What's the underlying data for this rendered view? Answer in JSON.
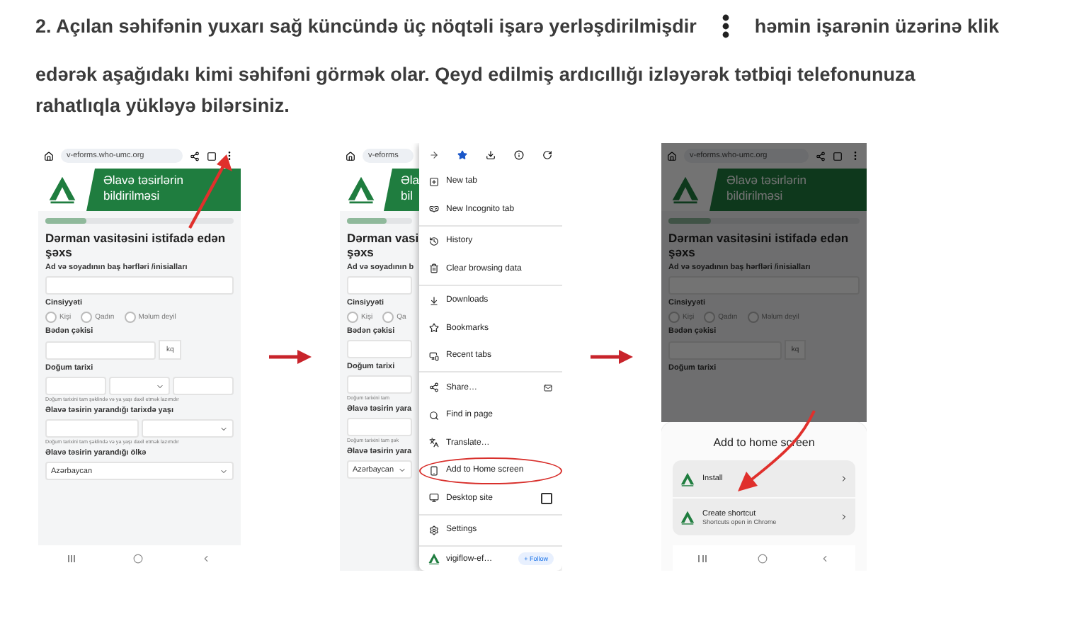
{
  "instruction": {
    "before_icon": "2. Açılan səhifənin yuxarı sağ küncündə üç nöqtəli işarə yerləşdirilmişdir",
    "after_icon": "həmin işarənin üzərinə klik",
    "continuation": "edərək aşağıdakı kimi səhifəni görmək olar. Qeyd edilmiş ardıcıllığı izləyərək tətbiqi telefonunuza rahatlıqla yükləyə bilərsiniz."
  },
  "steps": [
    {
      "kind": "page",
      "url": "v-eforms.who-umc.org",
      "banner": [
        "Əlavə təsirlərin",
        "bildirilməsi"
      ],
      "form": [
        {
          "kind": "progress",
          "level": 0.22
        },
        {
          "kind": "heading",
          "lines": [
            "Dərman vasitəsini istifadə edən",
            "şəxs"
          ]
        },
        {
          "kind": "label",
          "text": "Ad və soyadının baş hərfləri /inisialları"
        },
        {
          "kind": "input"
        },
        {
          "kind": "label",
          "text": "Cinsiyyəti"
        },
        {
          "kind": "radios",
          "options": [
            "Kişi",
            "Qadın",
            "Məlum deyil"
          ]
        },
        {
          "kind": "label",
          "text": "Bədən çəkisi"
        },
        {
          "kind": "unit_input",
          "unit": "kq"
        },
        {
          "kind": "label",
          "text": "Doğum tarixi"
        },
        {
          "kind": "date"
        },
        {
          "kind": "helper",
          "text": "Doğum tarixini tam şəklində və ya yaşı daxil etmək lazımdır"
        },
        {
          "kind": "label",
          "text": "Əlavə təsirin yarandığı tarixdə yaşı"
        },
        {
          "kind": "split_select"
        },
        {
          "kind": "helper",
          "text": "Doğum tarixini tam şəklində və ya yaşı daxil etmək lazımdır"
        },
        {
          "kind": "label",
          "text": "Əlavə təsirin yarandığı ölkə"
        },
        {
          "kind": "select",
          "value": "Azərbaycan"
        }
      ]
    },
    {
      "kind": "menu",
      "url": "v-eforms",
      "banner": [
        "Əla",
        "bil"
      ],
      "form": [
        {
          "kind": "progress",
          "level": 0.6
        },
        {
          "kind": "heading",
          "lines": [
            "Dərman vasi",
            "şəxs"
          ]
        },
        {
          "kind": "label",
          "text": "Ad və soyadının b"
        },
        {
          "kind": "input"
        },
        {
          "kind": "label",
          "text": "Cinsiyyəti"
        },
        {
          "kind": "radios",
          "options": [
            "Kişi",
            "Qa"
          ]
        },
        {
          "kind": "label",
          "text": "Bədən çəkisi"
        },
        {
          "kind": "input"
        },
        {
          "kind": "label",
          "text": "Doğum tarixi"
        },
        {
          "kind": "input"
        },
        {
          "kind": "helper",
          "text": "Doğum tarixini tam"
        },
        {
          "kind": "label",
          "text": "Əlavə təsirin yara"
        },
        {
          "kind": "input"
        },
        {
          "kind": "helper",
          "text": "Doğum tarixini tam şək"
        },
        {
          "kind": "label",
          "text": "Əlavə təsirin yara"
        },
        {
          "kind": "select",
          "value": "Azərbaycan"
        }
      ],
      "menu": {
        "groups": [
          [
            {
              "kind": "action",
              "label": "New tab",
              "circled": false
            },
            {
              "kind": "action",
              "label": "New Incognito tab",
              "circled": false
            }
          ],
          [
            {
              "kind": "action",
              "label": "History",
              "circled": false
            },
            {
              "kind": "action",
              "label": "Clear browsing data",
              "circled": false
            }
          ],
          [
            {
              "kind": "action",
              "label": "Downloads",
              "circled": false
            },
            {
              "kind": "action",
              "label": "Bookmarks",
              "circled": false
            },
            {
              "kind": "action",
              "label": "Recent tabs",
              "circled": false
            }
          ],
          [
            {
              "kind": "action",
              "label": "Share…",
              "circled": false
            },
            {
              "kind": "action",
              "label": "Find in page",
              "circled": false
            },
            {
              "kind": "action",
              "label": "Translate…",
              "circled": false
            },
            {
              "kind": "action",
              "label": "Add to Home screen",
              "circled": true
            },
            {
              "kind": "checkbox",
              "label": "Desktop site",
              "checked": false,
              "circled": false
            }
          ],
          [
            {
              "kind": "action",
              "label": "Settings",
              "circled": false
            }
          ]
        ],
        "footer": {
          "site": "vigiflow-ef…",
          "button": "+ Follow"
        }
      }
    },
    {
      "kind": "sheet",
      "url": "v-eforms.who-umc.org",
      "banner": [
        "Əlavə təsirlərin",
        "bildirilməsi"
      ],
      "form": [
        {
          "kind": "progress",
          "level": 0.22
        },
        {
          "kind": "heading",
          "lines": [
            "Dərman vasitəsini istifadə edən",
            "şəxs"
          ]
        },
        {
          "kind": "label",
          "text": "Ad və soyadının baş hərfləri /inisialları"
        },
        {
          "kind": "input"
        },
        {
          "kind": "label",
          "text": "Cinsiyyəti"
        },
        {
          "kind": "radios",
          "options": [
            "Kişi",
            "Qadın",
            "Məlum deyil"
          ]
        },
        {
          "kind": "label",
          "text": "Bədən çəkisi"
        },
        {
          "kind": "unit_input",
          "unit": "kq"
        },
        {
          "kind": "label",
          "text": "Doğum tarixi"
        }
      ],
      "sheet": {
        "title": "Add to home screen",
        "options": [
          {
            "label": "Install"
          },
          {
            "label": "Create shortcut",
            "subtitle": "Shortcuts open in Chrome"
          }
        ]
      }
    }
  ]
}
